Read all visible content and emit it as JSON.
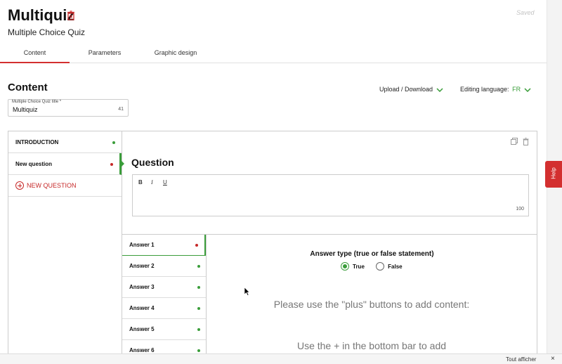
{
  "header": {
    "title": "Multiquiz",
    "subtitle": "Multiple Choice Quiz",
    "status": "Saved"
  },
  "tabs": [
    {
      "label": "Content",
      "active": true
    },
    {
      "label": "Parameters",
      "active": false
    },
    {
      "label": "Graphic design",
      "active": false
    }
  ],
  "content": {
    "heading": "Content",
    "upload_label": "Upload / Download",
    "editing_language_label": "Editing language:",
    "editing_language_value": "FR",
    "title_field": {
      "label": "Multiple Choice Quiz title *",
      "value": "Multiquiz",
      "counter": "41"
    }
  },
  "sidebar": {
    "items": [
      {
        "label": "INTRODUCTION",
        "status": "green"
      },
      {
        "label": "New question",
        "status": "red",
        "active": true
      }
    ],
    "add_label": "NEW QUESTION"
  },
  "question": {
    "heading": "Question",
    "toolbar": {
      "bold": "B",
      "italic": "I",
      "underline": "U"
    },
    "counter": "100"
  },
  "answers": [
    {
      "label": "Answer 1",
      "status": "red",
      "active": true
    },
    {
      "label": "Answer 2",
      "status": "green"
    },
    {
      "label": "Answer 3",
      "status": "green"
    },
    {
      "label": "Answer 4",
      "status": "green"
    },
    {
      "label": "Answer 5",
      "status": "green"
    },
    {
      "label": "Answer 6",
      "status": "green"
    }
  ],
  "answer_detail": {
    "type_title": "Answer type (true or false statement)",
    "options": [
      {
        "label": "True",
        "selected": true
      },
      {
        "label": "False",
        "selected": false
      }
    ],
    "hint_line1": "Please use the \"plus\" buttons to add content:",
    "hint_line2": "Use the + in the bottom bar to add"
  },
  "help": {
    "label": "Help"
  },
  "bottom_bar": {
    "show_all": "Tout afficher",
    "close": "×"
  },
  "colors": {
    "accent_red": "#d32f2f",
    "accent_green": "#3a9d3a"
  }
}
